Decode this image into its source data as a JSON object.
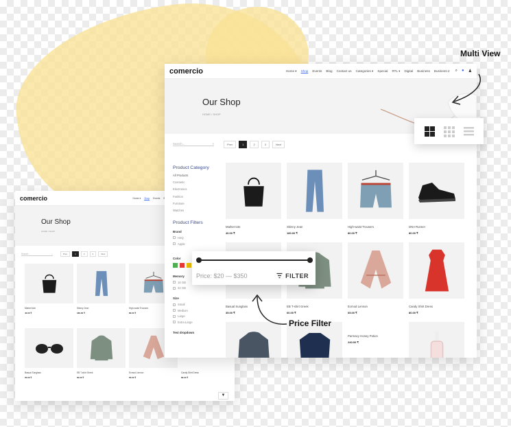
{
  "brand": "comercio",
  "nav": [
    "Home ▾",
    "Shop",
    "Events",
    "Blog",
    "Contact us",
    "Categories ▾",
    "Special",
    "RTL ▾",
    "Digital",
    "Business",
    "Business-2"
  ],
  "nav_active": 1,
  "hero": {
    "title": "Our Shop",
    "crumb": "HOME / SHOP"
  },
  "toolbar": {
    "search_placeholder": "Search...",
    "prev": "Prev",
    "pages": [
      "1",
      "2",
      "3"
    ],
    "next": "Next",
    "active_page": "1"
  },
  "sidebar": {
    "category_title": "Product Category",
    "categories": [
      "All Products",
      "Cosmetic",
      "Electronics",
      "Fashion",
      "Furniture",
      "Watches"
    ],
    "filters_title": "Product Filters",
    "brand_label": "Brand",
    "brands": [
      "H2Q",
      "Apple"
    ],
    "color_label": "Color",
    "colors": [
      "#4cb050",
      "#e53935",
      "#f2c200",
      "#e0e0e0"
    ],
    "memory_label": "Memory",
    "memory": [
      "16 GB",
      "32 GB"
    ],
    "size_label": "Size",
    "sizes": [
      "Small",
      "Medium",
      "Large",
      "Extra Large"
    ],
    "dropdown_label": "Test dropdown"
  },
  "products": [
    {
      "name": "Market tote",
      "price": "40.00 ₹"
    },
    {
      "name": "Skinny Jean",
      "price": "180.00 ₹"
    },
    {
      "name": "High-waist Trousers",
      "price": "80.00 ₹"
    },
    {
      "name": "DNA Runner",
      "price": "80.00 ₹"
    },
    {
      "name": "Basual Sunglass",
      "price": "35.00 ₹"
    },
    {
      "name": "EB T-shirt Greek",
      "price": "60.00 ₹"
    },
    {
      "name": "Ecmod Lennon",
      "price": "65.00 ₹"
    },
    {
      "name": "Candy Shirt Dress",
      "price": "80.00 ₹"
    },
    {
      "name": "",
      "price": ""
    },
    {
      "name": "",
      "price": ""
    },
    {
      "name": "Parmacy Honey Potion",
      "price": "240.00 ₹"
    },
    {
      "name": "",
      "price": ""
    }
  ],
  "products_small": [
    {
      "name": "Market tote",
      "price": "40.00 ₹"
    },
    {
      "name": "Skinny Jean",
      "price": "180.00 ₹"
    },
    {
      "name": "High-waist Trousers",
      "price": "80.00 ₹"
    },
    {
      "name": "",
      "price": ""
    },
    {
      "name": "Basual Sunglass",
      "price": "35.00 ₹"
    },
    {
      "name": "EB T-shirt Greek",
      "price": "60.00 ₹"
    },
    {
      "name": "Ecmod Lennon",
      "price": "65.00 ₹"
    },
    {
      "name": "Candy Shirt Dress",
      "price": "80.00 ₹"
    }
  ],
  "callouts": {
    "multi_view": "Multi View",
    "price_filter": "Price Filter"
  },
  "price_filter": {
    "range": "Price: $20 — $350",
    "button": "FILTER"
  },
  "views": [
    "grid-large-icon",
    "grid-small-icon",
    "list-icon"
  ]
}
